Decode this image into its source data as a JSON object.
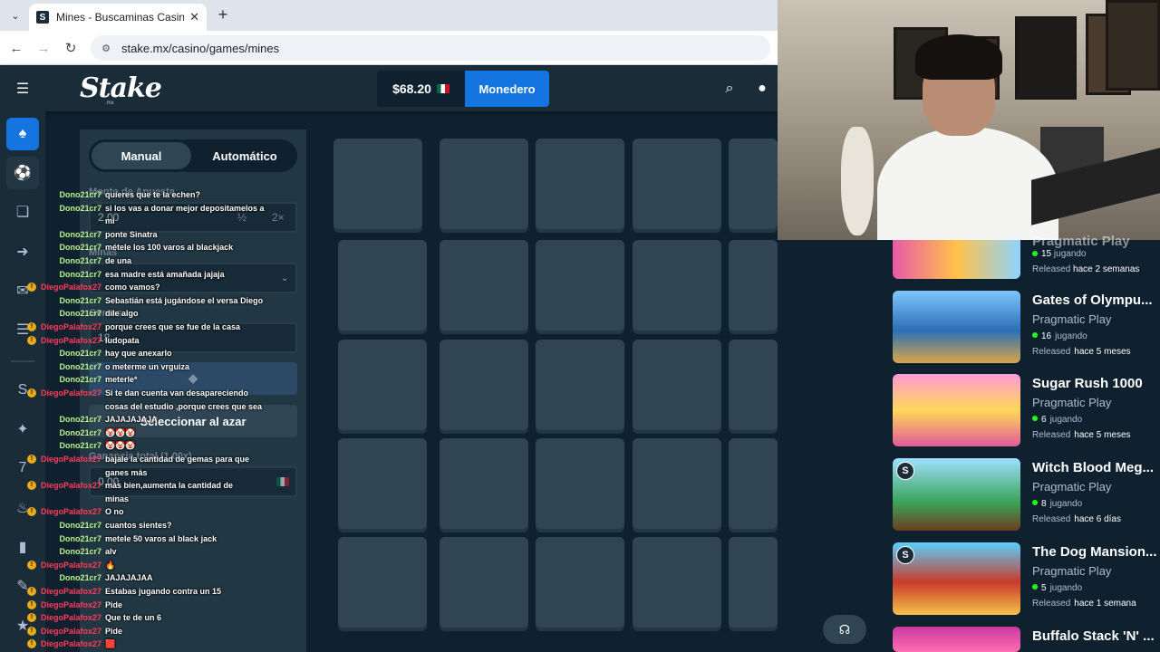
{
  "browser": {
    "tab_title": "Mines - Buscaminas Casino RTP",
    "url": "stake.mx/casino/games/mines"
  },
  "header": {
    "logo": "Stake",
    "logo_sub": ".mx",
    "balance": "$68.20",
    "wallet_label": "Monedero"
  },
  "panel": {
    "tab_manual": "Manual",
    "tab_auto": "Automático",
    "bet_label": "Monto de Apuesta",
    "bet_value": "2.00",
    "half": "½",
    "double": "2×",
    "mines_label": "Minas",
    "gems_label": "Gemas",
    "gems_value": "18",
    "random_button": "Seleccionar al azar",
    "profit_label": "Ganancia total (1.00x)",
    "profit_value": "0.00"
  },
  "chat": [
    {
      "user": "Dono21cr7",
      "color": "green",
      "badge": false,
      "text": "quieres que te la echen?"
    },
    {
      "user": "Dono21cr7",
      "color": "green",
      "badge": false,
      "text": "si los vas a donar mejor depositamelos a"
    },
    {
      "user": "",
      "color": "green",
      "badge": false,
      "text": "mi"
    },
    {
      "user": "Dono21cr7",
      "color": "green",
      "badge": false,
      "text": "ponte Sinatra"
    },
    {
      "user": "Dono21cr7",
      "color": "green",
      "badge": false,
      "text": "métele los 100 varos al blackjack"
    },
    {
      "user": "Dono21cr7",
      "color": "green",
      "badge": false,
      "text": "de una"
    },
    {
      "user": "Dono21cr7",
      "color": "green",
      "badge": false,
      "text": "esa madre está amañada jajaja"
    },
    {
      "user": "DiegoPalafox27",
      "color": "red",
      "badge": true,
      "text": "como vamos?"
    },
    {
      "user": "Dono21cr7",
      "color": "green",
      "badge": false,
      "text": "Sebastián está jugándose el versa Diego"
    },
    {
      "user": "Dono21cr7",
      "color": "green",
      "badge": false,
      "text": "dile algo"
    },
    {
      "user": "DiegoPalafox27",
      "color": "red",
      "badge": true,
      "text": "porque crees que se fue de la casa"
    },
    {
      "user": "DiegoPalafox27",
      "color": "red",
      "badge": true,
      "text": "ludopata"
    },
    {
      "user": "Dono21cr7",
      "color": "green",
      "badge": false,
      "text": "hay que anexarlo"
    },
    {
      "user": "Dono21cr7",
      "color": "green",
      "badge": false,
      "text": "o meterme un vrguiza"
    },
    {
      "user": "Dono21cr7",
      "color": "green",
      "badge": false,
      "text": "meterle*"
    },
    {
      "user": "DiegoPalafox27",
      "color": "red",
      "badge": true,
      "text": "Si te dan cuenta van desapareciendo"
    },
    {
      "user": "",
      "color": "green",
      "badge": false,
      "text": "cosas del estudio ,porque crees que sea"
    },
    {
      "user": "Dono21cr7",
      "color": "green",
      "badge": false,
      "text": "JAJAJAJAJA"
    },
    {
      "user": "Dono21cr7",
      "color": "green",
      "badge": false,
      "text": "🤡🤡🤡"
    },
    {
      "user": "Dono21cr7",
      "color": "green",
      "badge": false,
      "text": "🤡🤡🤡"
    },
    {
      "user": "DiegoPalafox27",
      "color": "red",
      "badge": true,
      "text": "bajale la cantidad de gemas para que"
    },
    {
      "user": "",
      "color": "green",
      "badge": false,
      "text": "ganes más"
    },
    {
      "user": "DiegoPalafox27",
      "color": "red",
      "badge": true,
      "text": "más bien,aumenta la cantidad de"
    },
    {
      "user": "",
      "color": "green",
      "badge": false,
      "text": "minas"
    },
    {
      "user": "DiegoPalafox27",
      "color": "red",
      "badge": true,
      "text": "O no"
    },
    {
      "user": "Dono21cr7",
      "color": "green",
      "badge": false,
      "text": "cuantos sientes?"
    },
    {
      "user": "Dono21cr7",
      "color": "green",
      "badge": false,
      "text": "metele 50 varos al black jack"
    },
    {
      "user": "Dono21cr7",
      "color": "green",
      "badge": false,
      "text": "alv"
    },
    {
      "user": "DiegoPalafox27",
      "color": "red",
      "badge": true,
      "text": "🔥"
    },
    {
      "user": "Dono21cr7",
      "color": "green",
      "badge": false,
      "text": "JAJAJAJAA"
    },
    {
      "user": "DiegoPalafox27",
      "color": "red",
      "badge": true,
      "text": "Estabas jugando contra un 15"
    },
    {
      "user": "DiegoPalafox27",
      "color": "red",
      "badge": true,
      "text": "Pide"
    },
    {
      "user": "DiegoPalafox27",
      "color": "red",
      "badge": true,
      "text": "Que te de un 6"
    },
    {
      "user": "DiegoPalafox27",
      "color": "red",
      "badge": true,
      "text": "Pide"
    },
    {
      "user": "DiegoPalafox27",
      "color": "red",
      "badge": true,
      "text": "🟥"
    }
  ],
  "games": [
    {
      "name": "Gates of Olympu...",
      "provider": "Pragmatic Play",
      "playing": "16",
      "playing_label": "jugando",
      "released_label": "Released",
      "released": "hace 5 meses",
      "stake_badge": false
    },
    {
      "name": "Sugar Rush 1000",
      "provider": "Pragmatic Play",
      "playing": "6",
      "playing_label": "jugando",
      "released_label": "Released",
      "released": "hace 5 meses",
      "stake_badge": false
    },
    {
      "name": "Witch Blood Meg...",
      "provider": "Pragmatic Play",
      "playing": "8",
      "playing_label": "jugando",
      "released_label": "Released",
      "released": "hace 6 días",
      "stake_badge": true
    },
    {
      "name": "The Dog Mansion...",
      "provider": "Pragmatic Play",
      "playing": "5",
      "playing_label": "jugando",
      "released_label": "Released",
      "released": "hace 1 semana",
      "stake_badge": true
    },
    {
      "name": "Buffalo Stack 'N' ...",
      "provider": "",
      "playing": "",
      "playing_label": "",
      "released_label": "",
      "released": "",
      "stake_badge": false
    }
  ],
  "partial_game": {
    "name": "Pragmatic Play",
    "playing": "15",
    "playing_label": "jugando",
    "released_label": "Released",
    "released": "hace 2 semanas"
  },
  "icons": {
    "tab_menu": "chevron-down-icon",
    "back": "arrow-left-icon",
    "forward": "arrow-right-icon",
    "reload": "reload-icon",
    "search": "search-icon",
    "user": "user-icon",
    "support": "headset-icon"
  },
  "colors": {
    "bg": "#0f212e",
    "panel": "#213743",
    "tile": "#2f4553",
    "accent_blue": "#1475e1"
  }
}
